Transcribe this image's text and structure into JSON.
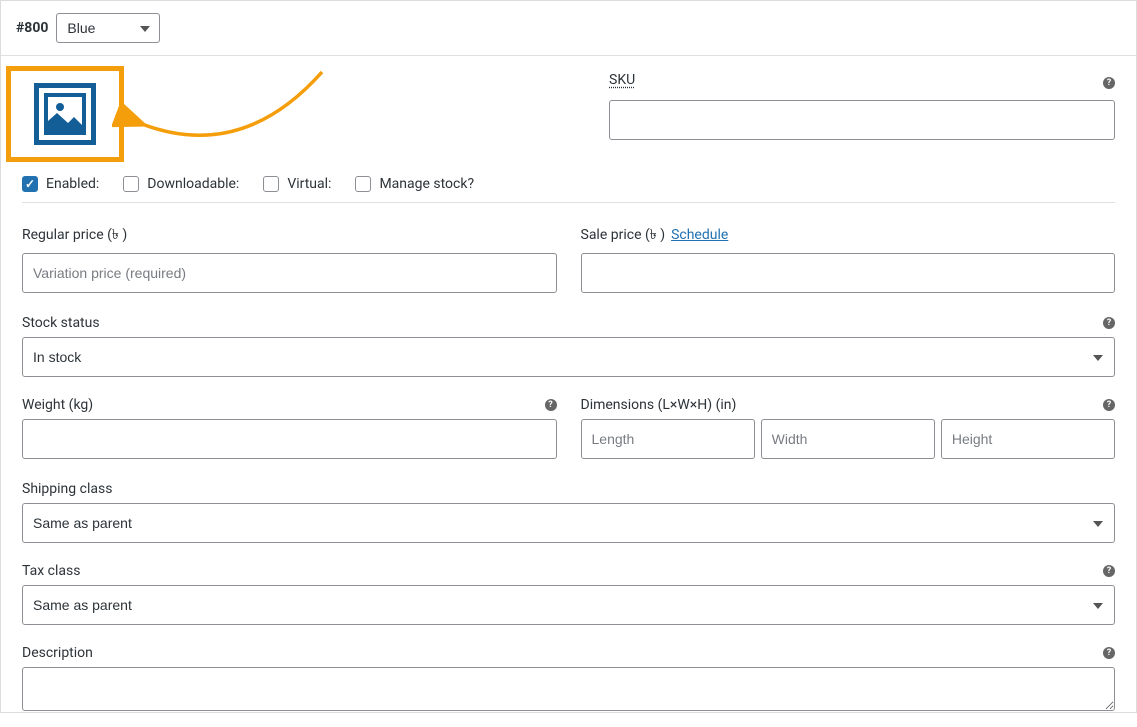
{
  "header": {
    "variation_id": "#800",
    "attribute_value": "Blue"
  },
  "sku": {
    "label": "SKU",
    "value": ""
  },
  "checkboxes": {
    "enabled": {
      "label": "Enabled:",
      "checked": true
    },
    "downloadable": {
      "label": "Downloadable:",
      "checked": false
    },
    "virtual": {
      "label": "Virtual:",
      "checked": false
    },
    "manage_stock": {
      "label": "Manage stock?",
      "checked": false
    }
  },
  "regular_price": {
    "label": "Regular price (৳ )",
    "placeholder": "Variation price (required)",
    "value": ""
  },
  "sale_price": {
    "label": "Sale price (৳ )",
    "schedule_text": "Schedule",
    "value": ""
  },
  "stock_status": {
    "label": "Stock status",
    "value": "In stock"
  },
  "weight": {
    "label": "Weight (kg)",
    "value": ""
  },
  "dimensions": {
    "label": "Dimensions (L×W×H) (in)",
    "length_placeholder": "Length",
    "width_placeholder": "Width",
    "height_placeholder": "Height",
    "length": "",
    "width": "",
    "height": ""
  },
  "shipping_class": {
    "label": "Shipping class",
    "value": "Same as parent"
  },
  "tax_class": {
    "label": "Tax class",
    "value": "Same as parent"
  },
  "description": {
    "label": "Description",
    "value": ""
  }
}
